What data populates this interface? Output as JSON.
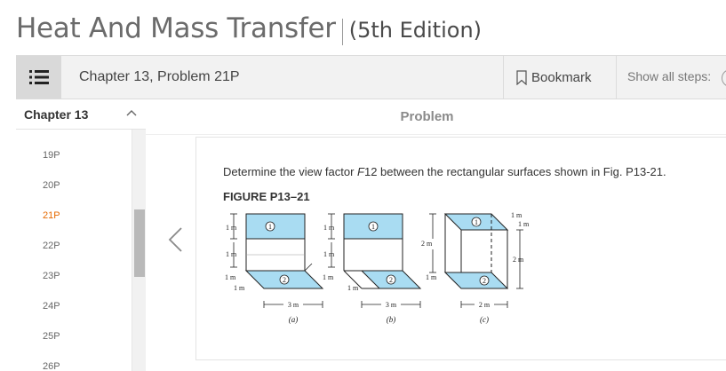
{
  "book": {
    "title": "Heat And Mass Transfer",
    "edition": "(5th Edition)"
  },
  "toolbar": {
    "chapter_problem": "Chapter 13, Problem 21P",
    "bookmark_label": "Bookmark",
    "show_steps_label": "Show all steps:"
  },
  "sidebar": {
    "chapter": "Chapter 13",
    "items": [
      "19P",
      "20P",
      "21P",
      "22P",
      "23P",
      "24P",
      "25P",
      "26P"
    ],
    "active_item": "21P"
  },
  "problem": {
    "header": "Problem",
    "text_before": "Determine the view factor ",
    "text_var": "F",
    "text_after": "12 between the rectangular surfaces shown in Fig. P13-21.",
    "figure_title": "FIGURE P13–21"
  },
  "figure": {
    "panels": [
      {
        "caption": "(a)",
        "width_label": "3 m",
        "heights": [
          "1 m",
          "1 m"
        ],
        "depths": [
          "1 m",
          "1 m"
        ]
      },
      {
        "caption": "(b)",
        "width_label": "3 m",
        "heights": [
          "1 m",
          "1 m"
        ],
        "depths": [
          "1 m",
          "1 m"
        ],
        "middle": "2 m"
      },
      {
        "caption": "(c)",
        "width_label": "2 m",
        "side_a": "1 m",
        "side_b": "1 m",
        "height": "2 m",
        "depth": "1 m"
      }
    ],
    "surface1": "1",
    "surface2": "2",
    "fill_color": "#a9dcf2"
  },
  "colors": {
    "active": "#e66a00",
    "toolbar_bg": "#f2f2f2",
    "menu_bg": "#d9d9d9"
  }
}
